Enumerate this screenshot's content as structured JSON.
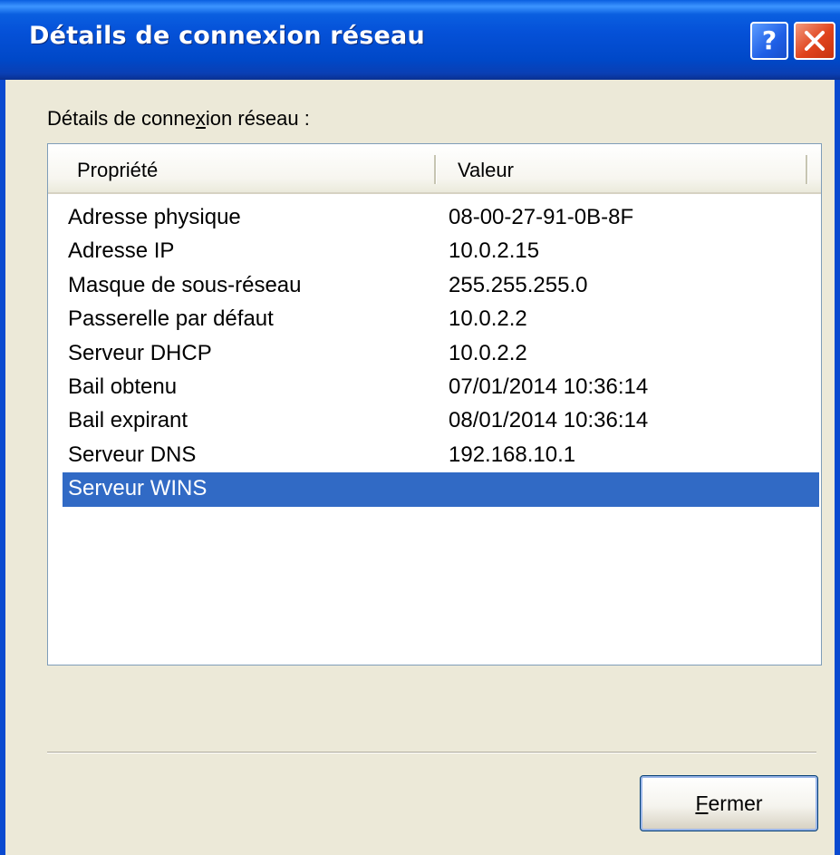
{
  "window": {
    "title": "Détails de connexion réseau",
    "help_glyph": "?",
    "close_icon": "close-icon"
  },
  "group": {
    "label_pre": "Détails de conne",
    "label_accel": "x",
    "label_post": "ion réseau :"
  },
  "list": {
    "columns": [
      "Propriété",
      "Valeur"
    ],
    "rows": [
      {
        "property": "Adresse physique",
        "value": "08-00-27-91-0B-8F"
      },
      {
        "property": "Adresse IP",
        "value": "10.0.2.15"
      },
      {
        "property": "Masque de sous-réseau",
        "value": "255.255.255.0"
      },
      {
        "property": "Passerelle par défaut",
        "value": "10.0.2.2"
      },
      {
        "property": "Serveur DHCP",
        "value": "10.0.2.2"
      },
      {
        "property": "Bail obtenu",
        "value": "07/01/2014 10:36:14"
      },
      {
        "property": "Bail expirant",
        "value": "08/01/2014 10:36:14"
      },
      {
        "property": "Serveur DNS",
        "value": "192.168.10.1"
      },
      {
        "property": "Serveur WINS",
        "value": ""
      }
    ],
    "selected_index": 8
  },
  "buttons": {
    "close_accel": "F",
    "close_rest": "ermer"
  },
  "colors": {
    "titlebar": "#0a5fe0",
    "selection": "#316ac5",
    "dialog_bg": "#ece9d8"
  }
}
